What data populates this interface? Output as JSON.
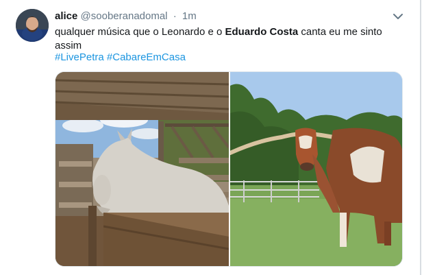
{
  "tweet": {
    "author": {
      "name": "alice",
      "handle": "@sooberanadomal"
    },
    "separator": "·",
    "timestamp": "1m",
    "text_parts": {
      "before": "qualquer música que o Leonardo e o ",
      "bold": "Eduardo Costa",
      "after": " canta eu me sinto assim"
    },
    "hashtags": [
      "#LivePetra",
      "#CabareEmCasa"
    ],
    "media": [
      {
        "subject": "white zebu cow in wooden pen"
      },
      {
        "subject": "texas longhorn bull in field"
      }
    ]
  },
  "colors": {
    "link": "#1b95e0",
    "secondary_text": "#657786",
    "primary_text": "#14171a",
    "border": "#e1e8ed"
  },
  "icons": {
    "menu": "chevron-down-icon"
  }
}
